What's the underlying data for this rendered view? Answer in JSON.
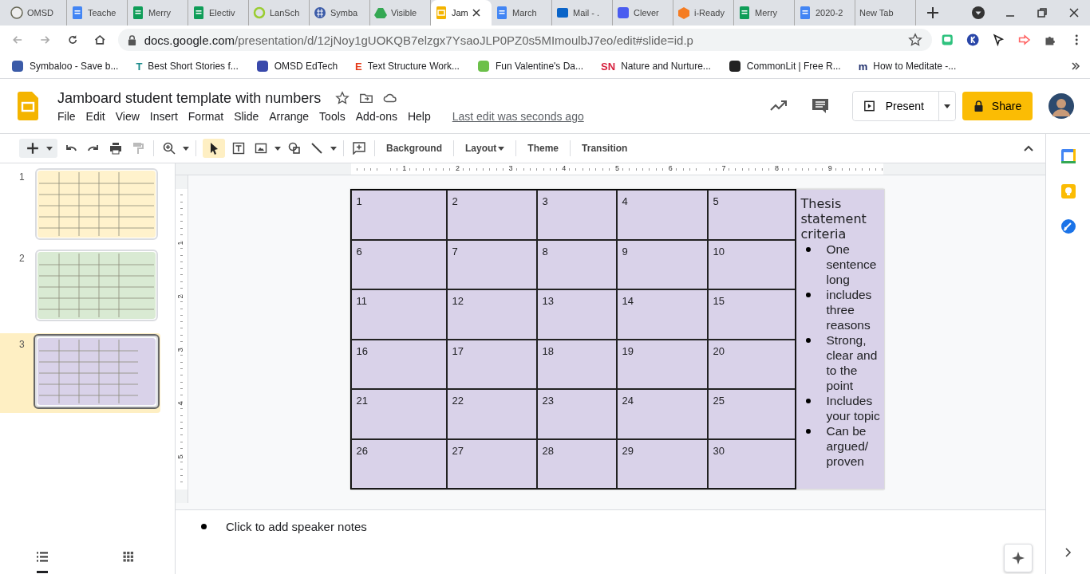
{
  "browser": {
    "tabs": [
      {
        "title": "OMSD",
        "kind": "seal",
        "selected": false
      },
      {
        "title": "Teache",
        "kind": "docs",
        "selected": false
      },
      {
        "title": "Merry",
        "kind": "sheets",
        "selected": false
      },
      {
        "title": "Electiv",
        "kind": "sheets",
        "selected": false
      },
      {
        "title": "LanSch",
        "kind": "ring",
        "selected": false
      },
      {
        "title": "Symba",
        "kind": "globe",
        "selected": false
      },
      {
        "title": "Visible",
        "kind": "drive",
        "selected": false
      },
      {
        "title": "Jam",
        "kind": "slides",
        "selected": true
      },
      {
        "title": "March",
        "kind": "docs",
        "selected": false
      },
      {
        "title": "Mail - .",
        "kind": "mail",
        "selected": false
      },
      {
        "title": "Clever",
        "kind": "clever",
        "selected": false
      },
      {
        "title": "i-Ready",
        "kind": "cube",
        "selected": false
      },
      {
        "title": "Merry",
        "kind": "sheets",
        "selected": false
      },
      {
        "title": "2020-2",
        "kind": "docs",
        "selected": false
      },
      {
        "title": "New Tab",
        "kind": "none",
        "selected": false
      }
    ],
    "url_host": "docs.google.com",
    "url_path": "/presentation/d/12jNoy1gUOKQB7elzgx7YsaoJLP0PZ0s5MImoulbJ7eo/edit#slide=id.p",
    "bookmarks": [
      {
        "title": "Symbaloo - Save b...",
        "color": "#3b5ba8"
      },
      {
        "title": "Best Short Stories f...",
        "badge": "T",
        "color": "#1a8a8a"
      },
      {
        "title": "OMSD EdTech",
        "color": "#3949ab"
      },
      {
        "title": "Text Structure Work...",
        "badge": "E",
        "color": "#e53918"
      },
      {
        "title": "Fun Valentine's Da...",
        "color": "#6cc04a"
      },
      {
        "title": "Nature and Nurture...",
        "badge": "SN",
        "color": "#d61f3c"
      },
      {
        "title": "CommonLit | Free R...",
        "color": "#222222"
      },
      {
        "title": "How to Meditate -...",
        "badge": "m",
        "color": "#1d2d6b"
      }
    ]
  },
  "doc": {
    "title": "Jamboard student template with numbers",
    "menu": [
      "File",
      "Edit",
      "View",
      "Insert",
      "Format",
      "Slide",
      "Arrange",
      "Tools",
      "Add-ons",
      "Help"
    ],
    "last_edit": "Last edit was seconds ago",
    "present": "Present",
    "share": "Share"
  },
  "toolbar": {
    "buttons": [
      "Background",
      "Layout",
      "Theme",
      "Transition"
    ]
  },
  "ruler": {
    "horizontal": [
      "1",
      "2",
      "3",
      "4",
      "5",
      "6",
      "7",
      "8",
      "9"
    ],
    "vertical": [
      "1",
      "2",
      "3",
      "4",
      "5"
    ]
  },
  "slides": [
    {
      "number": "1",
      "color": "#fff2cc",
      "selected": false
    },
    {
      "number": "2",
      "color": "#d9ead3",
      "selected": false
    },
    {
      "number": "3",
      "color": "#d9d2e9",
      "selected": true
    }
  ],
  "slide": {
    "rows": [
      [
        "1",
        "2",
        "3",
        "4",
        "5"
      ],
      [
        "6",
        "7",
        "8",
        "9",
        "10"
      ],
      [
        "11",
        "12",
        "13",
        "14",
        "15"
      ],
      [
        "16",
        "17",
        "18",
        "19",
        "20"
      ],
      [
        "21",
        "22",
        "23",
        "24",
        "25"
      ],
      [
        "26",
        "27",
        "28",
        "29",
        "30"
      ]
    ],
    "criteria": {
      "title": "Thesis statement criteria",
      "bullets": [
        "One sentence long",
        " includes three reasons",
        "Strong, clear and to the point",
        "Includes your topic",
        "Can be argued/ proven"
      ]
    }
  },
  "notes": {
    "placeholder": "Click to add speaker notes"
  },
  "view": {
    "list_selected": true
  }
}
